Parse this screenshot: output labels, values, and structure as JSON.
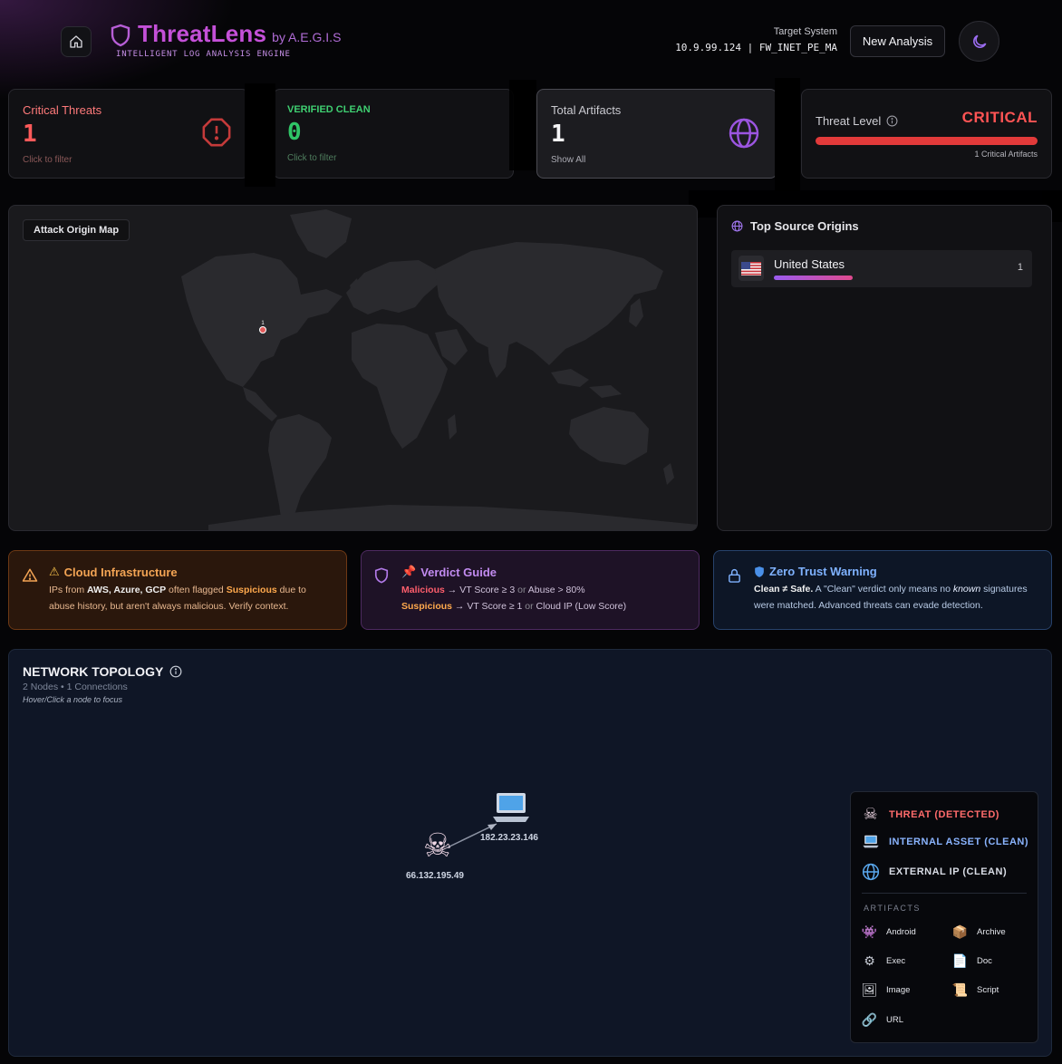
{
  "header": {
    "brand_name": "ThreatLens",
    "brand_by": "by A.E.G.I.S",
    "brand_sub": "INTELLIGENT LOG ANALYSIS ENGINE",
    "target_label": "Target System",
    "target_value": "10.9.99.124 | FW_INET_PE_MA",
    "new_analysis": "New Analysis"
  },
  "stats": {
    "critical": {
      "title": "Critical Threats",
      "value": "1",
      "hint": "Click to filter"
    },
    "clean": {
      "title": "VERIFIED CLEAN",
      "value": "0",
      "hint": "Click to filter"
    },
    "total": {
      "title": "Total Artifacts",
      "value": "1",
      "hint": "Show All"
    },
    "threat_level": {
      "title": "Threat Level",
      "value": "CRITICAL",
      "hint": "1 Critical Artifacts",
      "fill": 1.0
    }
  },
  "map": {
    "label": "Attack Origin Map",
    "marker_count": "1"
  },
  "origins": {
    "title": "Top Source Origins",
    "items": [
      {
        "country": "United States",
        "count": "1"
      }
    ]
  },
  "info": {
    "cloud": {
      "title": "Cloud Infrastructure",
      "t1": "IPs from ",
      "aws": "AWS, Azure, GCP",
      "t2": " often flagged ",
      "susp": "Suspicious",
      "t3": " due to abuse history, but aren't always malicious. Verify context."
    },
    "verdict": {
      "title": "Verdict Guide",
      "mal": "Malicious",
      "mal_rule1": " → VT Score ≥ 3 ",
      "mal_or": "or",
      "mal_rule2": " Abuse > 80%",
      "susp": "Suspicious",
      "susp_rule1": " → VT Score ≥ 1 ",
      "susp_or": "or",
      "susp_rule2": " Cloud IP (Low Score)"
    },
    "zero_trust": {
      "title": "Zero Trust Warning",
      "clean_safe": "Clean ≠ Safe.",
      "t1": " A \"Clean\" verdict only means no ",
      "known": "known",
      "t2": " signatures were matched. Advanced threats can evade detection."
    }
  },
  "topology": {
    "title": "NETWORK TOPOLOGY",
    "sub": "2 Nodes • 1 Connections",
    "hint": "Hover/Click a node to focus",
    "nodes": [
      {
        "label": "66.132.195.49",
        "type": "threat"
      },
      {
        "label": "182.23.23.146",
        "type": "internal"
      }
    ]
  },
  "legend": {
    "threat": "THREAT (DETECTED)",
    "internal": "INTERNAL ASSET (CLEAN)",
    "external": "EXTERNAL IP (CLEAN)",
    "artifacts_title": "ARTIFACTS",
    "artifacts": {
      "android": "Android",
      "archive": "Archive",
      "exec": "Exec",
      "doc": "Doc",
      "image": "Image",
      "script": "Script",
      "url": "URL"
    }
  },
  "colors": {
    "accent": "#c450d8",
    "critical": "#ff5454",
    "clean": "#2fc466",
    "threat_legend": "#ff6b6b",
    "internal_legend": "#8ab4ff"
  }
}
